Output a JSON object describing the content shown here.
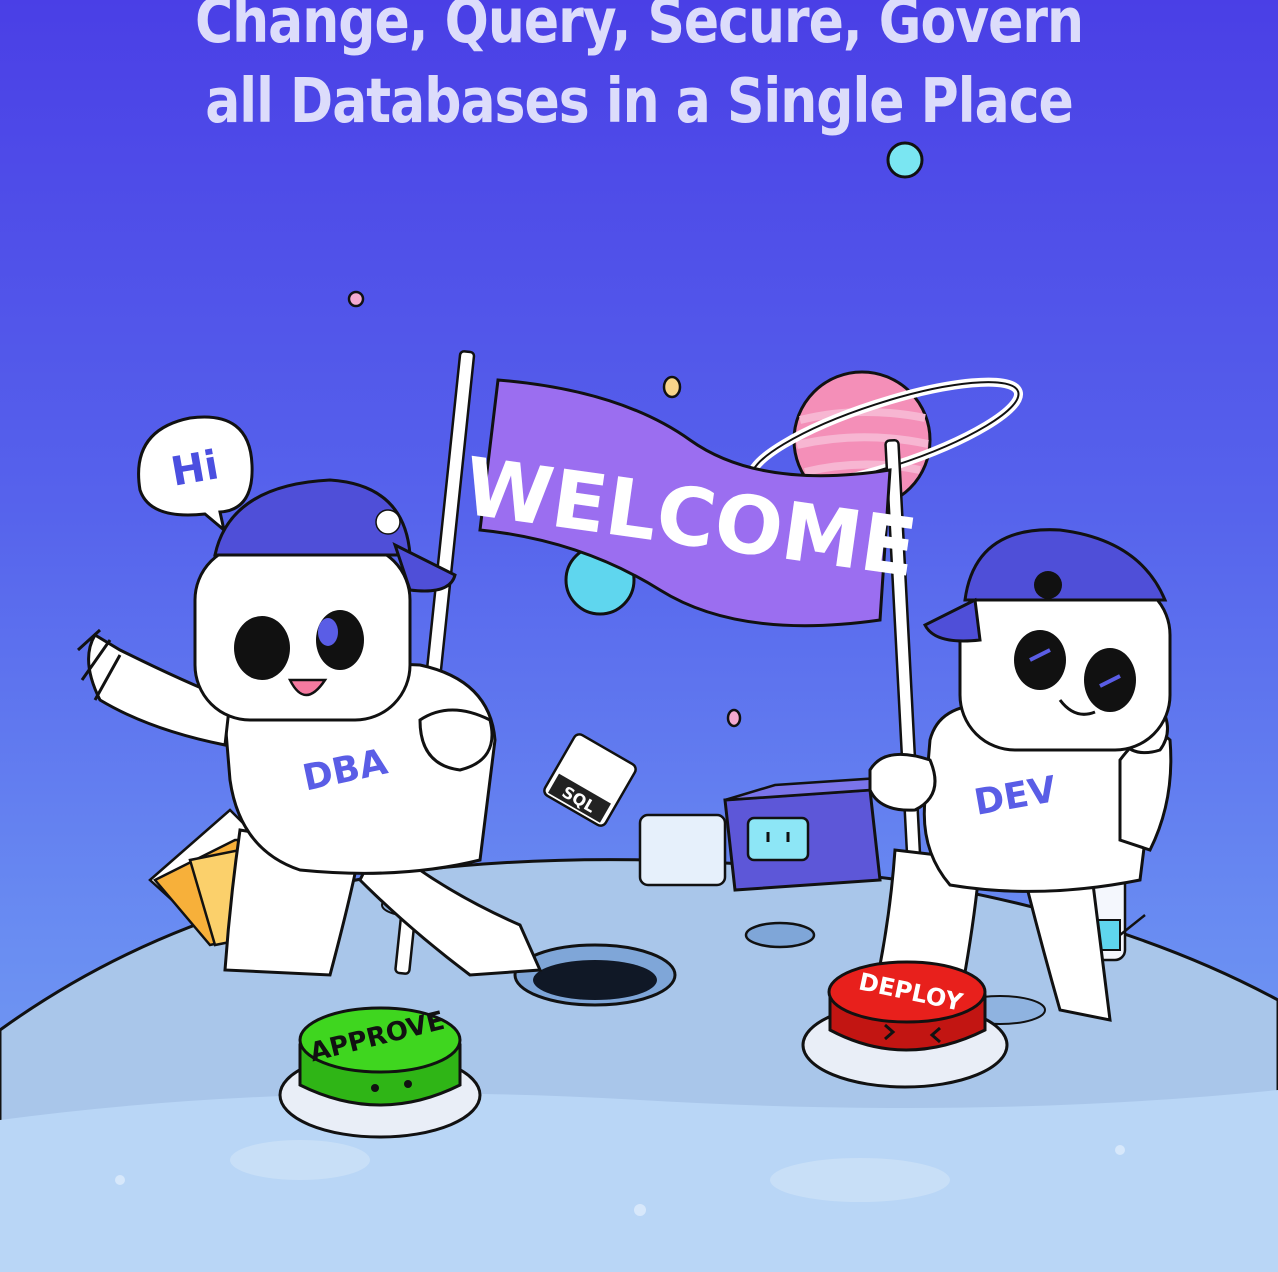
{
  "headline": {
    "line1": "Change, Query, Secure, Govern",
    "line2": "all Databases in a Single Place"
  },
  "illustration": {
    "banner_text": "WELCOME",
    "speech_bubble": "Hi",
    "left_character_label": "DBA",
    "right_character_label": "DEV",
    "green_button_label": "APPROVE",
    "red_button_label": "DEPLOY",
    "document_label": "SQL",
    "colors": {
      "background_top": "#4a3fe6",
      "background_bottom": "#7aa4f4",
      "banner": "#9b6ef0",
      "approve": "#3fd61f",
      "deploy": "#e8201c",
      "planet": "#f48fb8",
      "moon": "#a9c6ea"
    }
  }
}
